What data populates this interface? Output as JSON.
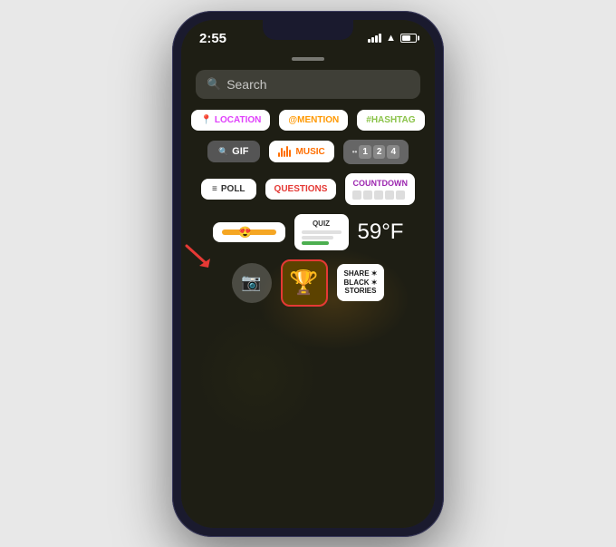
{
  "phone": {
    "status_bar": {
      "time": "2:55",
      "signal": "signal",
      "wifi": "wifi",
      "battery": "battery"
    },
    "search": {
      "placeholder": "Search"
    },
    "stickers": {
      "row1": [
        {
          "id": "location",
          "label": "LOCATION",
          "icon": "📍"
        },
        {
          "id": "mention",
          "label": "@MENTION"
        },
        {
          "id": "hashtag",
          "label": "#HASHTAG"
        }
      ],
      "row2": [
        {
          "id": "gif",
          "label": "GIF"
        },
        {
          "id": "music",
          "label": "MUSIC"
        },
        {
          "id": "counter",
          "digits": [
            "1",
            "2",
            "4"
          ]
        }
      ],
      "row3": [
        {
          "id": "poll",
          "label": "POLL"
        },
        {
          "id": "questions",
          "label": "QUESTIONS"
        },
        {
          "id": "countdown",
          "label": "COUNTDOWN"
        }
      ],
      "row4": [
        {
          "id": "slider",
          "emoji": "😍"
        },
        {
          "id": "quiz",
          "label": "QUIZ"
        },
        {
          "id": "temperature",
          "label": "59°F"
        }
      ],
      "row5": [
        {
          "id": "camera"
        },
        {
          "id": "badge",
          "emoji": "🏆"
        },
        {
          "id": "share",
          "lines": [
            "SHARE",
            "BLACK",
            "STORIES"
          ]
        }
      ]
    }
  }
}
